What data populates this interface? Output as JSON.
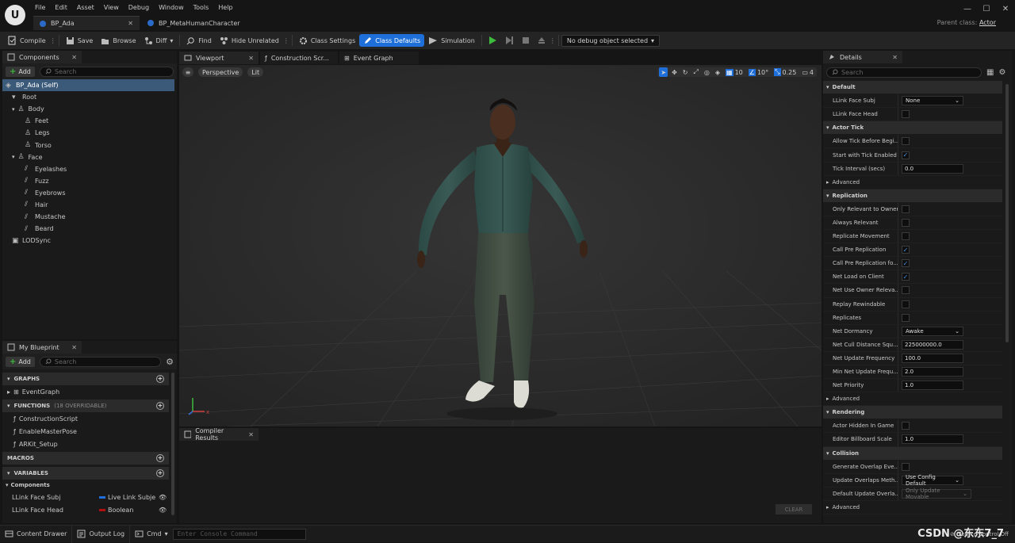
{
  "app": {
    "logo": "U",
    "menu": [
      "File",
      "Edit",
      "Asset",
      "View",
      "Debug",
      "Window",
      "Tools",
      "Help"
    ],
    "tabs": [
      "BP_Ada",
      "BP_MetaHumanCharacter"
    ],
    "parent_class_label": "Parent class:",
    "parent_class_value": "Actor",
    "window_controls": [
      "—",
      "☐",
      "✕"
    ]
  },
  "toolbar": {
    "compile": "Compile",
    "save": "Save",
    "browse": "Browse",
    "diff": "Diff",
    "find": "Find",
    "hide_unrelated": "Hide Unrelated",
    "class_settings": "Class Settings",
    "class_defaults": "Class Defaults",
    "simulation": "Simulation",
    "debug_object": "No debug object selected",
    "accent": "#1e6fd9",
    "play_color": "#3dbb3d"
  },
  "components": {
    "title": "Components",
    "add": "Add",
    "search_placeholder": "Search",
    "tree": [
      {
        "label": "BP_Ada (Self)",
        "indent": 0,
        "icon": "blueprint-icon"
      },
      {
        "label": "Root",
        "indent": 1,
        "icon": "chevron-down-icon"
      },
      {
        "label": "Body",
        "indent": 2,
        "icon": "skeletal-mesh-icon"
      },
      {
        "label": "Feet",
        "indent": 3,
        "icon": "skeletal-mesh-icon"
      },
      {
        "label": "Legs",
        "indent": 3,
        "icon": "skeletal-mesh-icon"
      },
      {
        "label": "Torso",
        "indent": 3,
        "icon": "skeletal-mesh-icon"
      },
      {
        "label": "Face",
        "indent": 2,
        "icon": "skeletal-mesh-icon"
      },
      {
        "label": "Eyelashes",
        "indent": 3,
        "icon": "groom-icon"
      },
      {
        "label": "Fuzz",
        "indent": 3,
        "icon": "groom-icon"
      },
      {
        "label": "Eyebrows",
        "indent": 3,
        "icon": "groom-icon"
      },
      {
        "label": "Hair",
        "indent": 3,
        "icon": "groom-icon"
      },
      {
        "label": "Mustache",
        "indent": 3,
        "icon": "groom-icon"
      },
      {
        "label": "Beard",
        "indent": 3,
        "icon": "groom-icon"
      },
      {
        "label": "LODSync",
        "indent": 1,
        "icon": "component-icon"
      }
    ]
  },
  "my_blueprint": {
    "title": "My Blueprint",
    "add": "Add",
    "search_placeholder": "Search",
    "graphs_header": "GRAPHS",
    "graphs": [
      "EventGraph"
    ],
    "functions_header": "FUNCTIONS",
    "functions_sub": "(18 OVERRIDABLE)",
    "functions": [
      "ConstructionScript",
      "EnableMasterPose",
      "ARKit_Setup"
    ],
    "macros_header": "MACROS",
    "variables_header": "VARIABLES",
    "components_group": "Components",
    "variables": [
      {
        "name": "LLink Face Subj",
        "type": "Live Link Subjec",
        "color": "#1e6fd9"
      },
      {
        "name": "LLink Face Head",
        "type": "Boolean",
        "color": "#b01010"
      }
    ]
  },
  "editor_tabs": [
    "Viewport",
    "Construction Scr...",
    "Event Graph"
  ],
  "viewport": {
    "perspective": "Perspective",
    "lit": "Lit",
    "grid": "10",
    "angle": "10°",
    "scale": "0.25",
    "camera_speed": "4"
  },
  "compiler": {
    "title": "Compiler Results",
    "clear": "CLEAR"
  },
  "details": {
    "title": "Details",
    "search_placeholder": "Search",
    "sections": [
      {
        "name": "Default",
        "rows": [
          {
            "label": "LLink Face Subj",
            "kind": "dropdown",
            "value": "None"
          },
          {
            "label": "LLink Face Head",
            "kind": "check",
            "checked": false
          }
        ]
      },
      {
        "name": "Actor Tick",
        "rows": [
          {
            "label": "Allow Tick Before Begi...",
            "kind": "check",
            "checked": false
          },
          {
            "label": "Start with Tick Enabled",
            "kind": "check",
            "checked": true
          },
          {
            "label": "Tick Interval (secs)",
            "kind": "text",
            "value": "0.0"
          }
        ],
        "advanced": "Advanced"
      },
      {
        "name": "Replication",
        "rows": [
          {
            "label": "Only Relevant to Owner",
            "kind": "check",
            "checked": false
          },
          {
            "label": "Always Relevant",
            "kind": "check",
            "checked": false
          },
          {
            "label": "Replicate Movement",
            "kind": "check",
            "checked": false
          },
          {
            "label": "Call Pre Replication",
            "kind": "check",
            "checked": true
          },
          {
            "label": "Call Pre Replication fo...",
            "kind": "check",
            "checked": true
          },
          {
            "label": "Net Load on Client",
            "kind": "check",
            "checked": true
          },
          {
            "label": "Net Use Owner Releva...",
            "kind": "check",
            "checked": false
          },
          {
            "label": "Replay Rewindable",
            "kind": "check",
            "checked": false
          },
          {
            "label": "Replicates",
            "kind": "check",
            "checked": false
          },
          {
            "label": "Net Dormancy",
            "kind": "dropdown",
            "value": "Awake"
          },
          {
            "label": "Net Cull Distance Squ...",
            "kind": "text",
            "value": "225000000.0"
          },
          {
            "label": "Net Update Frequency",
            "kind": "text",
            "value": "100.0"
          },
          {
            "label": "Min Net Update Frequ...",
            "kind": "text",
            "value": "2.0"
          },
          {
            "label": "Net Priority",
            "kind": "text",
            "value": "1.0"
          }
        ],
        "advanced": "Advanced"
      },
      {
        "name": "Rendering",
        "rows": [
          {
            "label": "Actor Hidden In Game",
            "kind": "check",
            "checked": false
          },
          {
            "label": "Editor Billboard Scale",
            "kind": "text",
            "value": "1.0"
          }
        ]
      },
      {
        "name": "Collision",
        "rows": [
          {
            "label": "Generate Overlap Eve...",
            "kind": "check",
            "checked": false
          },
          {
            "label": "Update Overlaps Meth...",
            "kind": "dropdown",
            "value": "Use Config Default"
          },
          {
            "label": "Default Update Overla...",
            "kind": "dropdown_disabled",
            "value": "Only Update Movable"
          }
        ],
        "advanced": "Advanced"
      }
    ]
  },
  "statusbar": {
    "content_drawer": "Content Drawer",
    "output_log": "Output Log",
    "cmd": "Cmd",
    "console_placeholder": "Enter Console Command",
    "source_control": "Source Control Off",
    "watermark": "CSDN @东东7_7"
  }
}
